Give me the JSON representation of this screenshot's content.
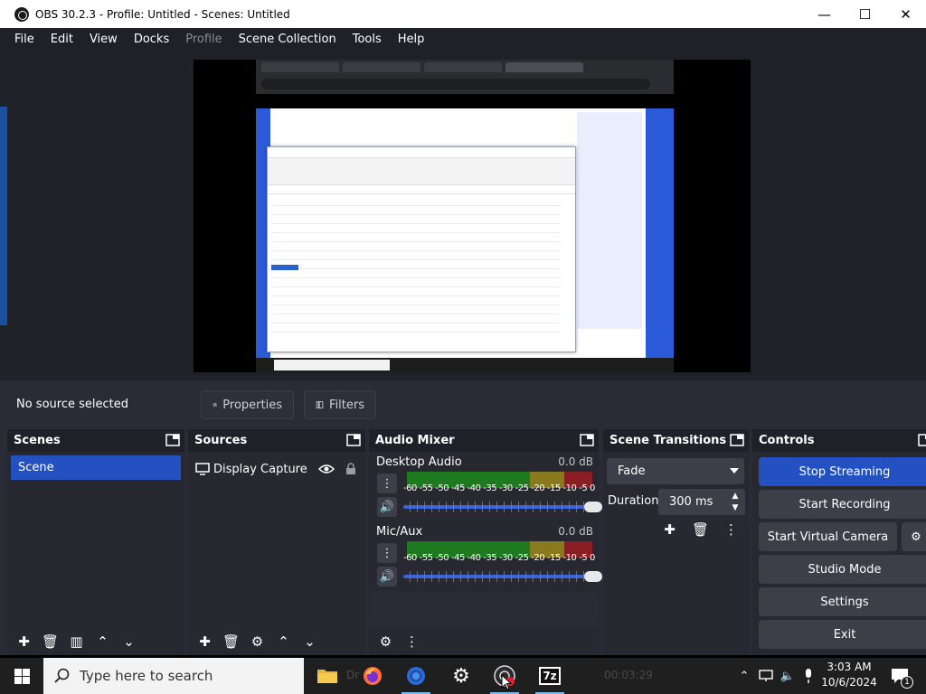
{
  "window": {
    "title": "OBS 30.2.3 - Profile: Untitled - Scenes: Untitled",
    "min": "—",
    "max": "☐",
    "close": "✕"
  },
  "menu": [
    {
      "label": "File",
      "enabled": true
    },
    {
      "label": "Edit",
      "enabled": true
    },
    {
      "label": "View",
      "enabled": true
    },
    {
      "label": "Docks",
      "enabled": true
    },
    {
      "label": "Profile",
      "enabled": false
    },
    {
      "label": "Scene Collection",
      "enabled": true
    },
    {
      "label": "Tools",
      "enabled": true
    },
    {
      "label": "Help",
      "enabled": true
    }
  ],
  "source_bar": {
    "status": "No source selected",
    "properties": "Properties",
    "filters": "Filters"
  },
  "scenes": {
    "title": "Scenes",
    "items": [
      "Scene"
    ],
    "selected": "Scene"
  },
  "sources": {
    "title": "Sources",
    "items": [
      {
        "name": "Display Capture",
        "visible": true,
        "locked": false
      }
    ]
  },
  "mixer": {
    "title": "Audio Mixer",
    "channels": [
      {
        "name": "Desktop Audio",
        "db": "0.0 dB",
        "volume": 1.0
      },
      {
        "name": "Mic/Aux",
        "db": "0.0 dB",
        "volume": 1.0
      }
    ],
    "ticks": [
      "-60",
      "-55",
      "-50",
      "-45",
      "-40",
      "-35",
      "-30",
      "-25",
      "-20",
      "-15",
      "-10",
      "-5",
      "0"
    ]
  },
  "transitions": {
    "title": "Scene Transitions",
    "selected": "Fade",
    "duration_label": "Duration",
    "duration_value": "300 ms"
  },
  "controls": {
    "title": "Controls",
    "stop_streaming": "Stop Streaming",
    "start_recording": "Start Recording",
    "start_virtual_camera": "Start Virtual Camera",
    "studio_mode": "Studio Mode",
    "settings": "Settings",
    "exit": "Exit"
  },
  "taskbar": {
    "search_placeholder": "Type here to search",
    "time": "3:03 AM",
    "date": "10/6/2024",
    "notification_count": "1",
    "ghost_stream_time": "00:03:29",
    "ghost_app_text": "7z"
  },
  "colors": {
    "accent": "#2351c2",
    "panel": "#2a2c35",
    "header": "#1f2129",
    "meter_green": "#1e7a1e",
    "meter_yellow": "#8a7a1e",
    "meter_red": "#8a1e24"
  }
}
